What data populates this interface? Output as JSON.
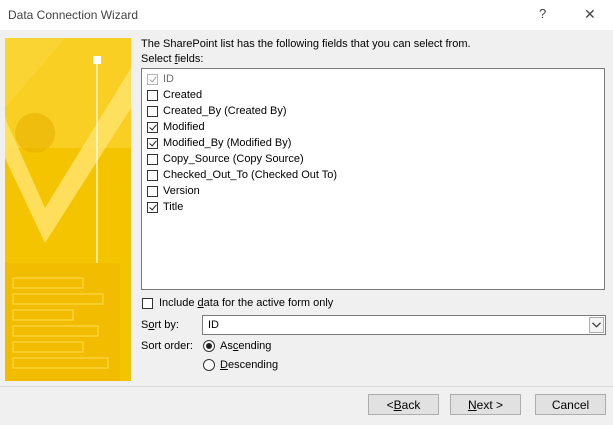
{
  "window": {
    "title": "Data Connection Wizard",
    "help_glyph": "?",
    "close_glyph": "✕"
  },
  "instructions": "The SharePoint list has the following fields that you can select from.",
  "select_fields": {
    "pre": "Select ",
    "underlined": "f",
    "post": "ields:"
  },
  "fields": [
    {
      "label": "ID",
      "checked": true,
      "disabled": true
    },
    {
      "label": "Created",
      "checked": false
    },
    {
      "label": "Created_By (Created By)",
      "checked": false
    },
    {
      "label": "Modified",
      "checked": true
    },
    {
      "label": "Modified_By (Modified By)",
      "checked": true
    },
    {
      "label": "Copy_Source (Copy Source)",
      "checked": false
    },
    {
      "label": "Checked_Out_To (Checked Out To)",
      "checked": false
    },
    {
      "label": "Version",
      "checked": false
    },
    {
      "label": "Title",
      "checked": true
    }
  ],
  "include_data": {
    "pre": "Include ",
    "underlined": "d",
    "post": "ata for the active form only",
    "checked": false
  },
  "sort_by": {
    "pre": "S",
    "underlined": "o",
    "post": "rt by:",
    "value": "ID"
  },
  "sort_order": {
    "label": "Sort order:",
    "ascending": {
      "pre": "As",
      "underlined": "c",
      "post": "ending",
      "selected": true
    },
    "descending": {
      "pre": "",
      "underlined": "D",
      "post": "escending",
      "selected": false
    }
  },
  "buttons": {
    "back": {
      "pre": "< ",
      "underlined": "B",
      "post": "ack"
    },
    "next": {
      "pre": "",
      "underlined": "N",
      "post": "ext >"
    },
    "cancel": "Cancel"
  },
  "colors": {
    "banner_yellow": "#f5c400",
    "banner_light": "#ffe36a",
    "banner_dark": "#e6a800"
  }
}
